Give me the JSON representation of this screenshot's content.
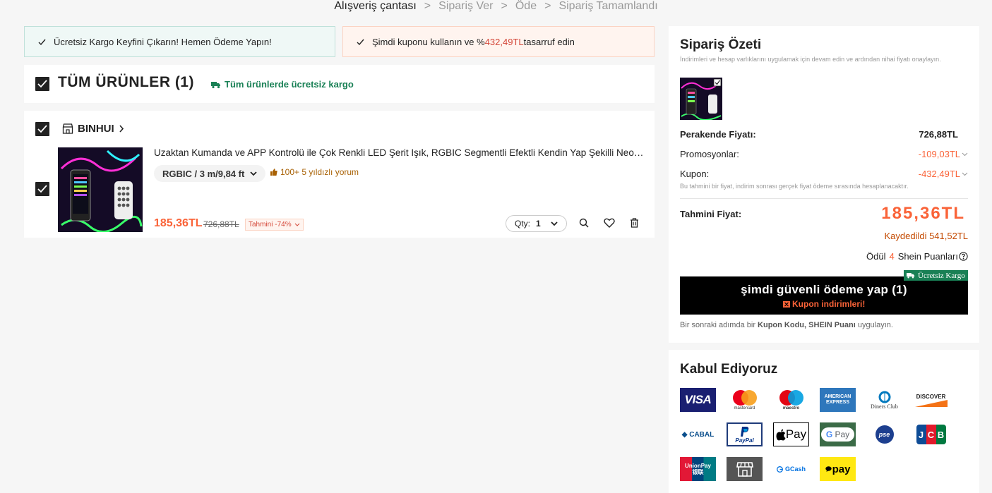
{
  "breadcrumb": [
    "Alışveriş çantası",
    "Sipariş Ver",
    "Öde",
    "Sipariş Tamamlandı"
  ],
  "banners": {
    "left": "Ücretsiz Kargo Keyfini Çıkarın! Hemen Ödeme Yapın!",
    "right_prefix": "Şimdi kuponu kullanın ve %",
    "right_amount": "432,49TL",
    "right_suffix": " tasarruf edin"
  },
  "cart": {
    "all_title": "TÜM ÜRÜNLER (1)",
    "free_shipping": "Tüm ürünlerde ücretsiz kargo",
    "store_name": "BINHUI",
    "item": {
      "title": "Uzaktan Kumanda ve APP Kontrolü ile Çok Renkli LED Şerit Işık, RGBIC Segmentli Efektli Kendin Yap Şekilli Neon Işık Şeridi",
      "variant": "RGBIC / 3 m/9,84 ft",
      "reviews": "100+ 5 yıldızlı yorum",
      "price": "185,36TL",
      "old_price": "726,88TL",
      "discount_badge": "Tahmini -74%",
      "qty_label": "Qty:",
      "qty_value": "1"
    }
  },
  "summary": {
    "title": "Sipariş Özeti",
    "note": "İndirimleri ve hesap varlıklarını uygulamak için devam edin ve ardından nihai fiyatı onaylayın.",
    "retail_label": "Perakende Fiyatı:",
    "retail_value": "726,88TL",
    "promo_label": "Promosyonlar:",
    "promo_value": "-109,03TL",
    "coupon_label": "Kupon:",
    "coupon_value": "-432,49TL",
    "estimate_note": "Bu tahmini bir fiyat, indirim sonrası gerçek fiyat ödeme sırasında hesaplanacaktır.",
    "estimated_label": "Tahmini Fiyat:",
    "estimated_value": "185,36TL",
    "saved": "Kaydedildi 541,52TL",
    "points_prefix": "Ödül",
    "points_value": "4",
    "points_suffix": "Shein Puanları",
    "pay_button": "şimdi güvenli ödeme yap (1)",
    "coupon_discounts": "Kupon indirimleri!",
    "free_ship_badge": "Ücretsiz Kargo",
    "bottom_note_1": "Bir sonraki adımda bir ",
    "bottom_note_b1": "Kupon Kodu, SHEIN Puanı",
    "bottom_note_2": " uygulayın."
  },
  "accept": {
    "title": "Kabul Ediyoruz",
    "methods": [
      "VISA",
      "mastercard",
      "maestro",
      "AMERICAN EXPRESS",
      "Diners Club",
      "DISCOVER",
      "CABAL",
      "PayPal",
      "Pay",
      "G Pay",
      "pse",
      "JCB",
      "UnionPay 银联",
      "store",
      "GCash",
      "pay"
    ]
  },
  "colors": {
    "accent_orange": "#fa6338",
    "green": "#198055",
    "dark": "#222222"
  }
}
